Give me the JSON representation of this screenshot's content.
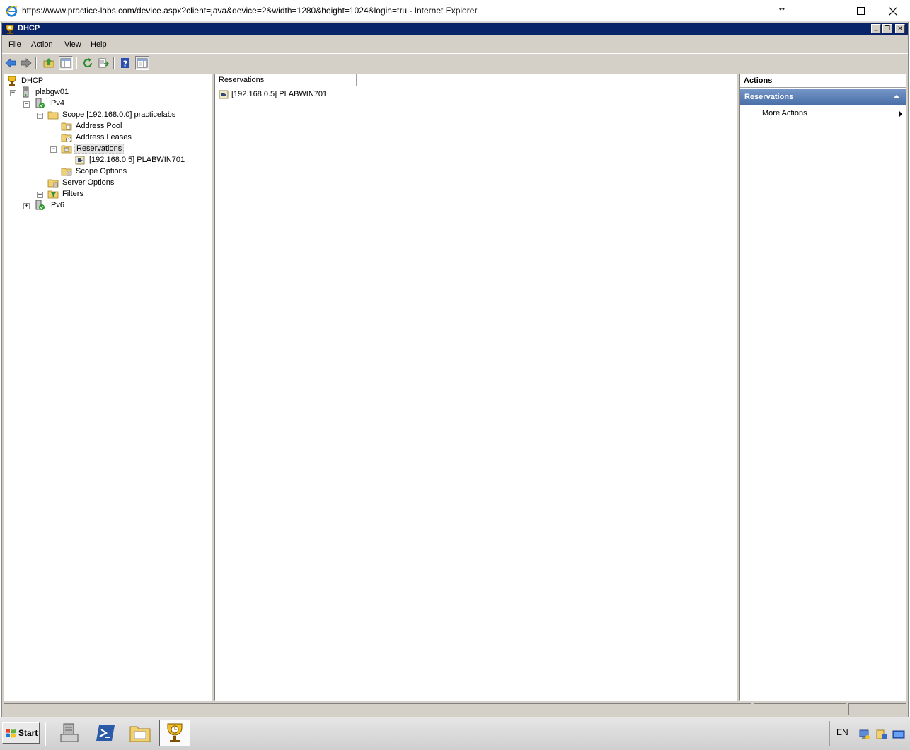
{
  "browser": {
    "title": "https://www.practice-labs.com/device.aspx?client=java&device=2&width=1280&height=1024&login=tru - Internet Explorer",
    "resize_glyph": "↔",
    "min_glyph": "—",
    "max_glyph": "☐",
    "close_glyph": "✕"
  },
  "window": {
    "title": "DHCP",
    "mdi_min": "_",
    "mdi_restore": "❐",
    "mdi_close": "✕"
  },
  "menu": {
    "file": "File",
    "action": "Action",
    "view": "View",
    "help": "Help"
  },
  "toolbar": {
    "icons": [
      "back-arrow-icon",
      "forward-arrow-icon",
      "up-folder-icon",
      "show-hide-tree-icon",
      "refresh-icon",
      "export-list-icon",
      "help-icon",
      "show-hide-action-pane-icon"
    ]
  },
  "tree": {
    "root": "DHCP",
    "server": "plabgw01",
    "ipv4": "IPv4",
    "scope": "Scope [192.168.0.0] practicelabs",
    "address_pool": "Address Pool",
    "address_leases": "Address Leases",
    "reservations": "Reservations",
    "reservation_item": "[192.168.0.5] PLABWIN701",
    "scope_options": "Scope Options",
    "server_options": "Server Options",
    "filters": "Filters",
    "ipv6": "IPv6",
    "expanded_glyph": "−",
    "collapsed_glyph": "+"
  },
  "list": {
    "column_header": "Reservations",
    "rows": [
      "[192.168.0.5] PLABWIN701"
    ]
  },
  "actions": {
    "header": "Actions",
    "section": "Reservations",
    "more_actions": "More Actions"
  },
  "taskbar": {
    "start": "Start",
    "language": "EN"
  },
  "colors": {
    "title_bar": "#0a246a",
    "actions_section": "#4a6fa8",
    "chrome": "#d4d0c8"
  }
}
